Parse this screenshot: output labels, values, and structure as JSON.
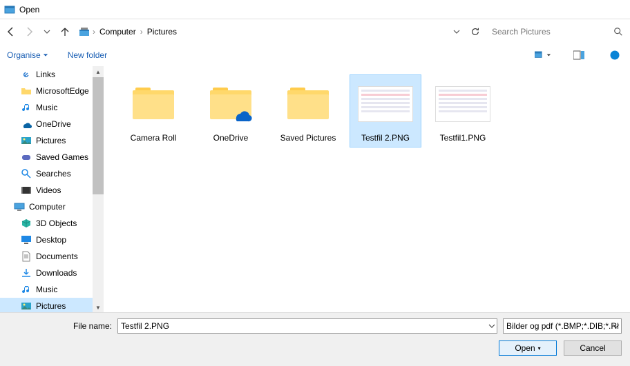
{
  "window": {
    "title": "Open"
  },
  "nav": {
    "back_enabled": true,
    "forward_enabled": false
  },
  "breadcrumb": [
    "Computer",
    "Pictures"
  ],
  "search": {
    "placeholder": "Search Pictures"
  },
  "toolbar": {
    "organise": "Organise",
    "new_folder": "New folder"
  },
  "sidebar": {
    "items": [
      {
        "label": "Links",
        "icon": "link",
        "lvl": 1
      },
      {
        "label": "MicrosoftEdge",
        "icon": "folder",
        "lvl": 1
      },
      {
        "label": "Music",
        "icon": "music",
        "lvl": 1
      },
      {
        "label": "OneDrive",
        "icon": "onedrive",
        "lvl": 1
      },
      {
        "label": "Pictures",
        "icon": "pictures",
        "lvl": 1
      },
      {
        "label": "Saved Games",
        "icon": "games",
        "lvl": 1
      },
      {
        "label": "Searches",
        "icon": "search",
        "lvl": 1
      },
      {
        "label": "Videos",
        "icon": "videos",
        "lvl": 1
      },
      {
        "label": "Computer",
        "icon": "computer",
        "lvl": 0
      },
      {
        "label": "3D Objects",
        "icon": "3d",
        "lvl": 1
      },
      {
        "label": "Desktop",
        "icon": "desktop",
        "lvl": 1
      },
      {
        "label": "Documents",
        "icon": "documents",
        "lvl": 1
      },
      {
        "label": "Downloads",
        "icon": "downloads",
        "lvl": 1
      },
      {
        "label": "Music",
        "icon": "music",
        "lvl": 1
      },
      {
        "label": "Pictures",
        "icon": "pictures",
        "lvl": 1,
        "selected": true
      }
    ]
  },
  "content": {
    "items": [
      {
        "label": "Camera Roll",
        "type": "folder"
      },
      {
        "label": "OneDrive",
        "type": "folder-onedrive"
      },
      {
        "label": "Saved Pictures",
        "type": "folder"
      },
      {
        "label": "Testfil 2.PNG",
        "type": "image",
        "selected": true
      },
      {
        "label": "Testfil1.PNG",
        "type": "image"
      }
    ]
  },
  "footer": {
    "filename_label": "File name:",
    "filename_value": "Testfil 2.PNG",
    "filetype_value": "Bilder og pdf (*.BMP;*.DIB;*.RLE",
    "open": "Open",
    "cancel": "Cancel"
  }
}
